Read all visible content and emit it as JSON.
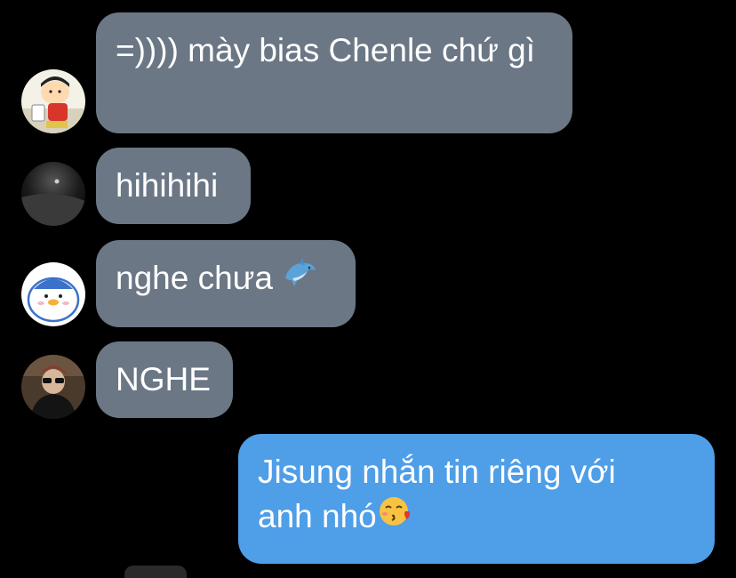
{
  "colors": {
    "background": "#000000",
    "incoming_bubble": "#6b7785",
    "outgoing_bubble": "#4e9ee8",
    "text": "#ffffff"
  },
  "messages": [
    {
      "direction": "incoming",
      "avatar_icon": "cartoon-boy-avatar-icon",
      "text": "=)))) mày bias Chenle chứ gì"
    },
    {
      "direction": "incoming",
      "avatar_icon": "dark-space-avatar-icon",
      "text": "hihihihi"
    },
    {
      "direction": "incoming",
      "avatar_icon": "penguin-avatar-icon",
      "text": "nghe chưa",
      "emoji_icon": "dolphin-icon"
    },
    {
      "direction": "incoming",
      "avatar_icon": "person-sunglasses-avatar-icon",
      "text": "NGHE"
    },
    {
      "direction": "outgoing",
      "text": "Jisung nhắn tin riêng với anh nhó",
      "emoji_icon": "kissing-face-heart-icon"
    }
  ]
}
